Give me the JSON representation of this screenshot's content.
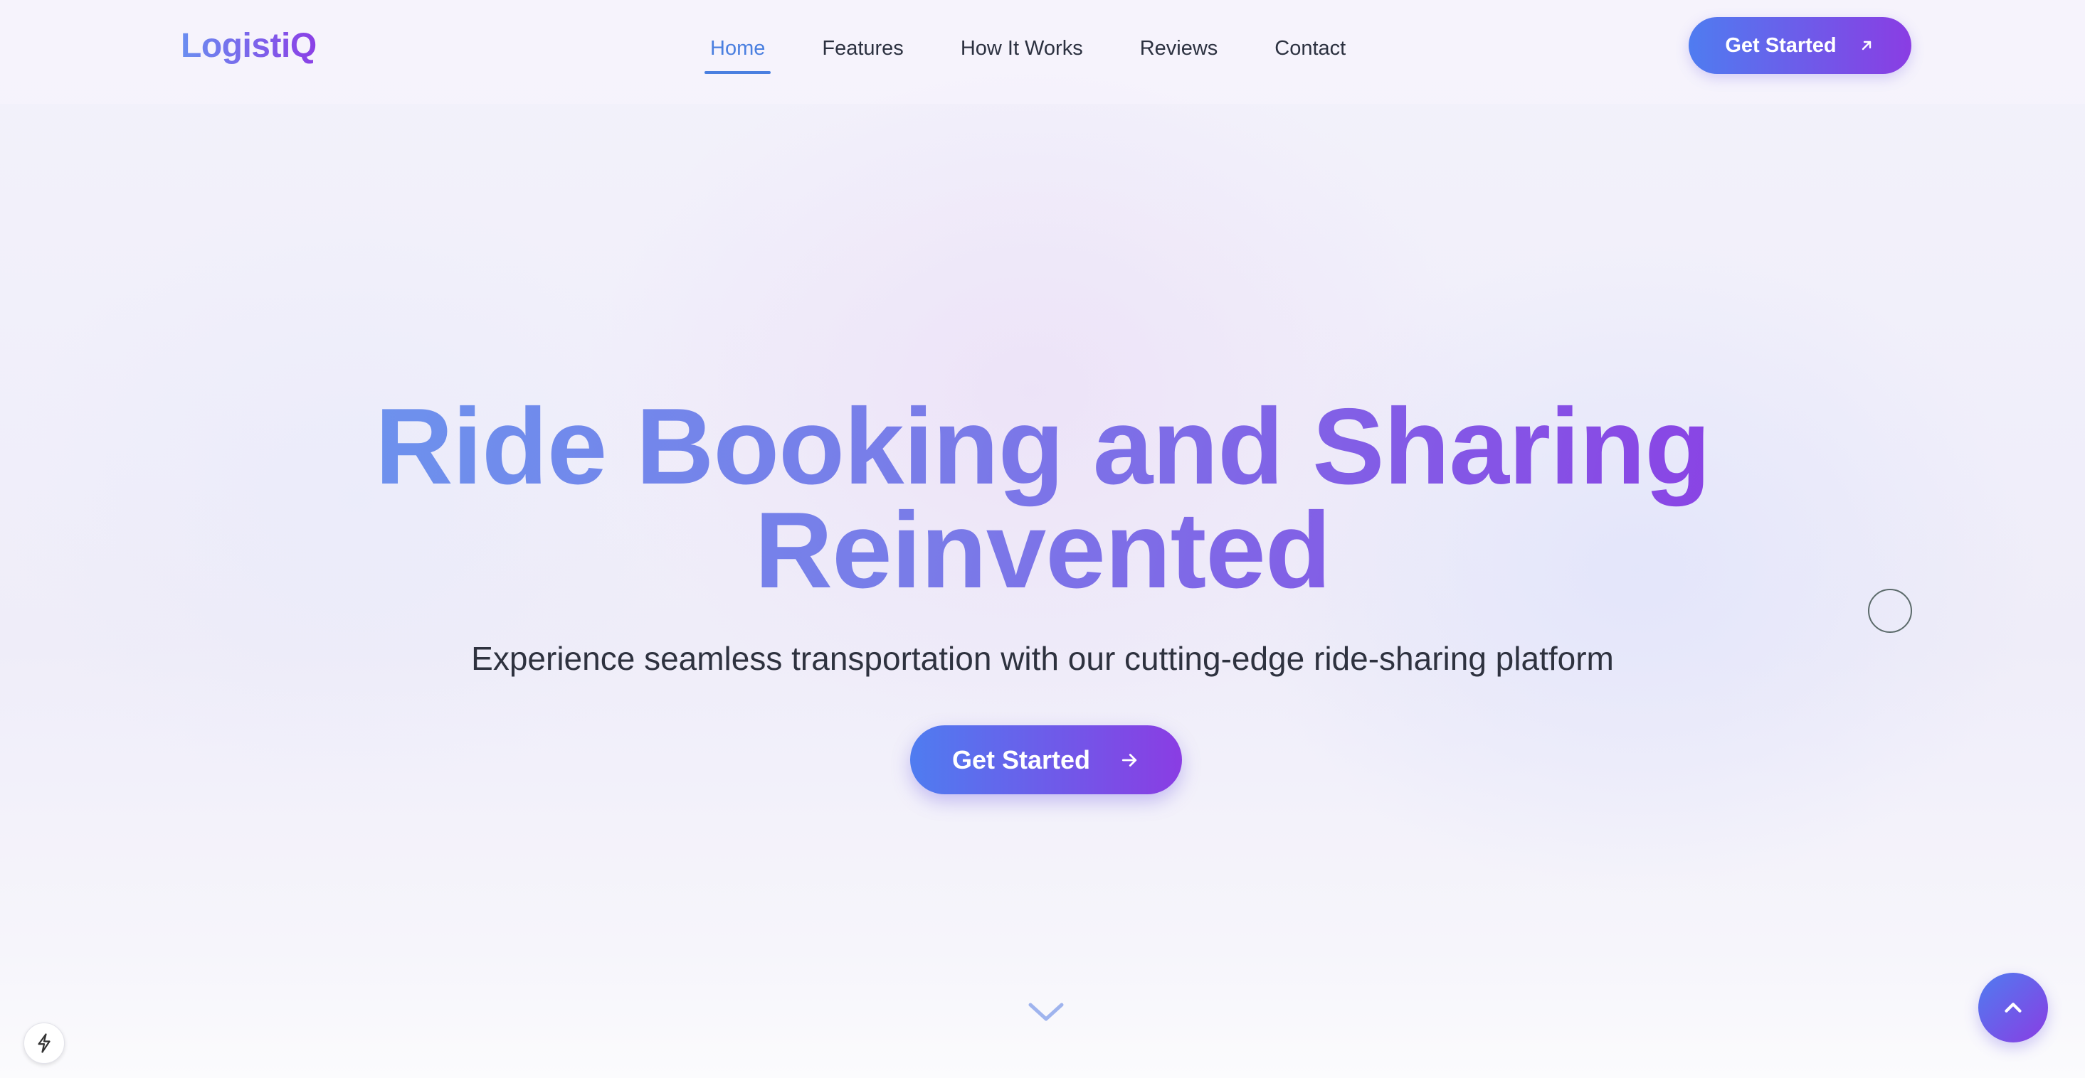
{
  "navbar": {
    "logo": "LogistiQ",
    "links": [
      {
        "label": "Home",
        "active": true
      },
      {
        "label": "Features",
        "active": false
      },
      {
        "label": "How It Works",
        "active": false
      },
      {
        "label": "Reviews",
        "active": false
      },
      {
        "label": "Contact",
        "active": false
      }
    ],
    "cta_label": "Get Started",
    "cta_icon": "arrow-up-right-icon"
  },
  "hero": {
    "title_line1": "Ride Booking and Sharing",
    "title_line2": "Reinvented",
    "subtitle": "Experience seamless transportation with our cutting-edge ride-sharing platform",
    "cta_label": "Get Started",
    "cta_icon": "arrow-right-icon"
  },
  "floating": {
    "scroll_indicator_icon": "chevron-down-icon",
    "back_to_top_icon": "chevron-up-icon",
    "dev_badge_icon": "lightning-icon"
  },
  "colors": {
    "accent_start": "#4f7cf0",
    "accent_end": "#8a3de3",
    "active_link": "#4a7fe0",
    "text_dark": "#2c3140"
  }
}
